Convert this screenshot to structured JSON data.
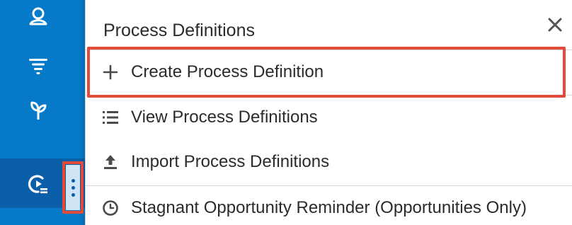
{
  "nav_rail": {
    "items": [
      {
        "icon": "contacts-icon"
      },
      {
        "icon": "filter-icon"
      },
      {
        "icon": "plant-icon"
      },
      {
        "icon": "process-icon",
        "active": true
      }
    ],
    "more_icon": "kebab-icon"
  },
  "panel": {
    "title": "Process Definitions",
    "close_glyph": "✕",
    "menu": [
      {
        "label": "Create Process Definition",
        "icon": "plus-icon"
      },
      {
        "label": "View Process Definitions",
        "icon": "list-icon"
      },
      {
        "label": "Import Process Definitions",
        "icon": "upload-icon"
      },
      {
        "label": "Stagnant Opportunity Reminder (Opportunities Only)",
        "icon": "clock-icon"
      }
    ]
  },
  "colors": {
    "rail": "#0679c8",
    "rail_active": "#0b5ea8",
    "highlight": "#e24a3a",
    "text": "#2b2b2b"
  }
}
